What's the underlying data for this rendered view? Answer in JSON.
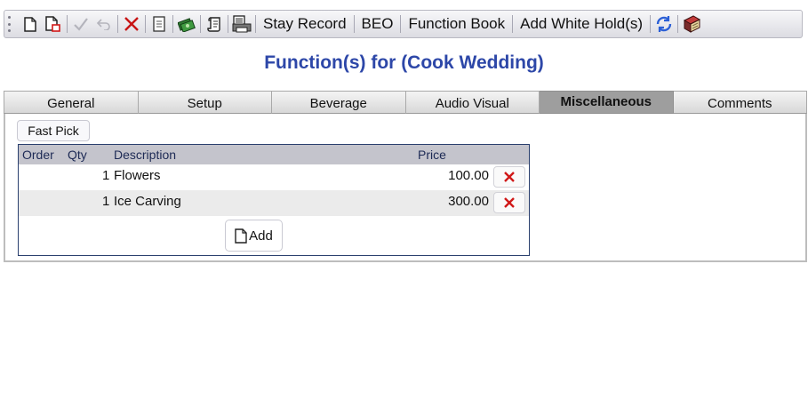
{
  "toolbar": {
    "icons": [
      "new-document-icon",
      "delete-document-icon",
      "check-icon",
      "undo-icon",
      "cancel-x-icon",
      "notes-icon",
      "money-icon",
      "scroll-icon",
      "print-icon",
      "refresh-icon",
      "book-icon"
    ],
    "stay_record_label": "Stay Record",
    "beo_label": "BEO",
    "function_book_label": "Function Book",
    "add_white_holds_label": "Add White Hold(s)"
  },
  "page": {
    "title": "Function(s) for (Cook Wedding)"
  },
  "tabs": [
    {
      "label": "General",
      "active": false
    },
    {
      "label": "Setup",
      "active": false
    },
    {
      "label": "Beverage",
      "active": false
    },
    {
      "label": "Audio Visual",
      "active": false
    },
    {
      "label": "Miscellaneous",
      "active": true
    },
    {
      "label": "Comments",
      "active": false
    }
  ],
  "misc": {
    "fast_pick_label": "Fast Pick",
    "columns": {
      "order": "Order",
      "qty": "Qty",
      "description": "Description",
      "price": "Price"
    },
    "rows": [
      {
        "qty": "1",
        "description": "Flowers",
        "price": "100.00"
      },
      {
        "qty": "1",
        "description": "Ice Carving",
        "price": "300.00"
      }
    ],
    "add_label": "Add"
  },
  "colors": {
    "title": "#2d47a8",
    "delete": "#d01818",
    "active_tab": "#9e9e9e"
  }
}
